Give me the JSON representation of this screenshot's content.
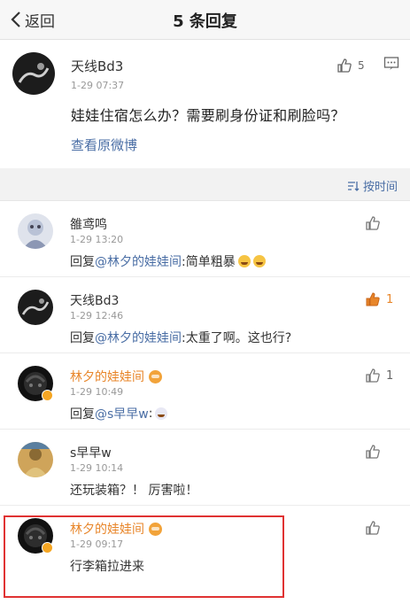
{
  "nav": {
    "back_label": "返回",
    "title": "5 条回复"
  },
  "post": {
    "user": "天线Bd3",
    "time": "1-29 07:37",
    "likes": "5",
    "text": "娃娃住宿怎么办？需要刷身份证和刷脸吗？",
    "link": "查看原微博"
  },
  "sort_label": "按时间",
  "replies": [
    {
      "user": "雒鸢鸣",
      "time": "1-29 13:20",
      "prefix": "回复",
      "mention": "@林夕的娃娃间",
      "text": ":简单粗暴",
      "likes": ""
    },
    {
      "user": "天线Bd3",
      "time": "1-29 12:46",
      "prefix": "回复",
      "mention": "@林夕的娃娃间",
      "text": ":太重了啊。这也行?",
      "likes": "1"
    },
    {
      "user": "林夕的娃娃间",
      "time": "1-29 10:49",
      "prefix": "回复",
      "mention": "@s早早w",
      "text": ":",
      "likes": "1"
    },
    {
      "user": "s早早w",
      "time": "1-29 10:14",
      "prefix": "",
      "mention": "",
      "text": "还玩装箱？！ 厉害啦！",
      "likes": ""
    },
    {
      "user": "林夕的娃娃间",
      "time": "1-29 09:17",
      "prefix": "",
      "mention": "",
      "text": "行李箱拉进来",
      "likes": ""
    }
  ],
  "colors": {
    "accent_orange": "#e8862a",
    "link_blue": "#4a6ea5",
    "highlight_red": "#e03232"
  }
}
